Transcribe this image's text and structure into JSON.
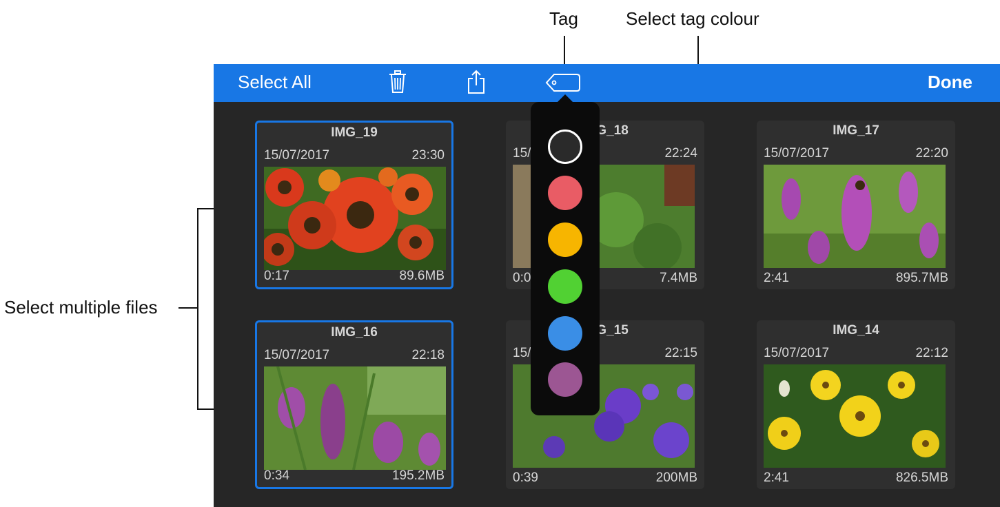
{
  "annotations": {
    "tag": "Tag",
    "select_tag_colour": "Select tag colour",
    "select_multiple_files": "Select multiple files"
  },
  "toolbar": {
    "select_all_label": "Select All",
    "done_label": "Done",
    "icons": [
      "trash-icon",
      "share-icon",
      "tag-icon"
    ],
    "color": "#1877e5"
  },
  "tag_colors": {
    "swatches": [
      {
        "name": "none",
        "color": "#2a2a2a"
      },
      {
        "name": "red",
        "color": "#e95c65"
      },
      {
        "name": "orange",
        "color": "#f7b500"
      },
      {
        "name": "green",
        "color": "#51d133"
      },
      {
        "name": "blue",
        "color": "#3a8ee6"
      },
      {
        "name": "purple",
        "color": "#9c5693"
      }
    ]
  },
  "files": [
    {
      "name": "IMG_19",
      "date": "15/07/2017",
      "time": "23:30",
      "duration": "0:17",
      "size": "89.6MB",
      "selected": true
    },
    {
      "name": "IMG_18",
      "date": "15/07/2017",
      "time": "22:24",
      "duration": "0:02",
      "size": "7.4MB",
      "selected": false
    },
    {
      "name": "IMG_17",
      "date": "15/07/2017",
      "time": "22:20",
      "duration": "2:41",
      "size": "895.7MB",
      "selected": false
    },
    {
      "name": "IMG_16",
      "date": "15/07/2017",
      "time": "22:18",
      "duration": "0:34",
      "size": "195.2MB",
      "selected": true
    },
    {
      "name": "IMG_15",
      "date": "15/07/2017",
      "time": "22:15",
      "duration": "0:39",
      "size": "200MB",
      "selected": false
    },
    {
      "name": "IMG_14",
      "date": "15/07/2017",
      "time": "22:12",
      "duration": "2:41",
      "size": "826.5MB",
      "selected": false
    }
  ]
}
